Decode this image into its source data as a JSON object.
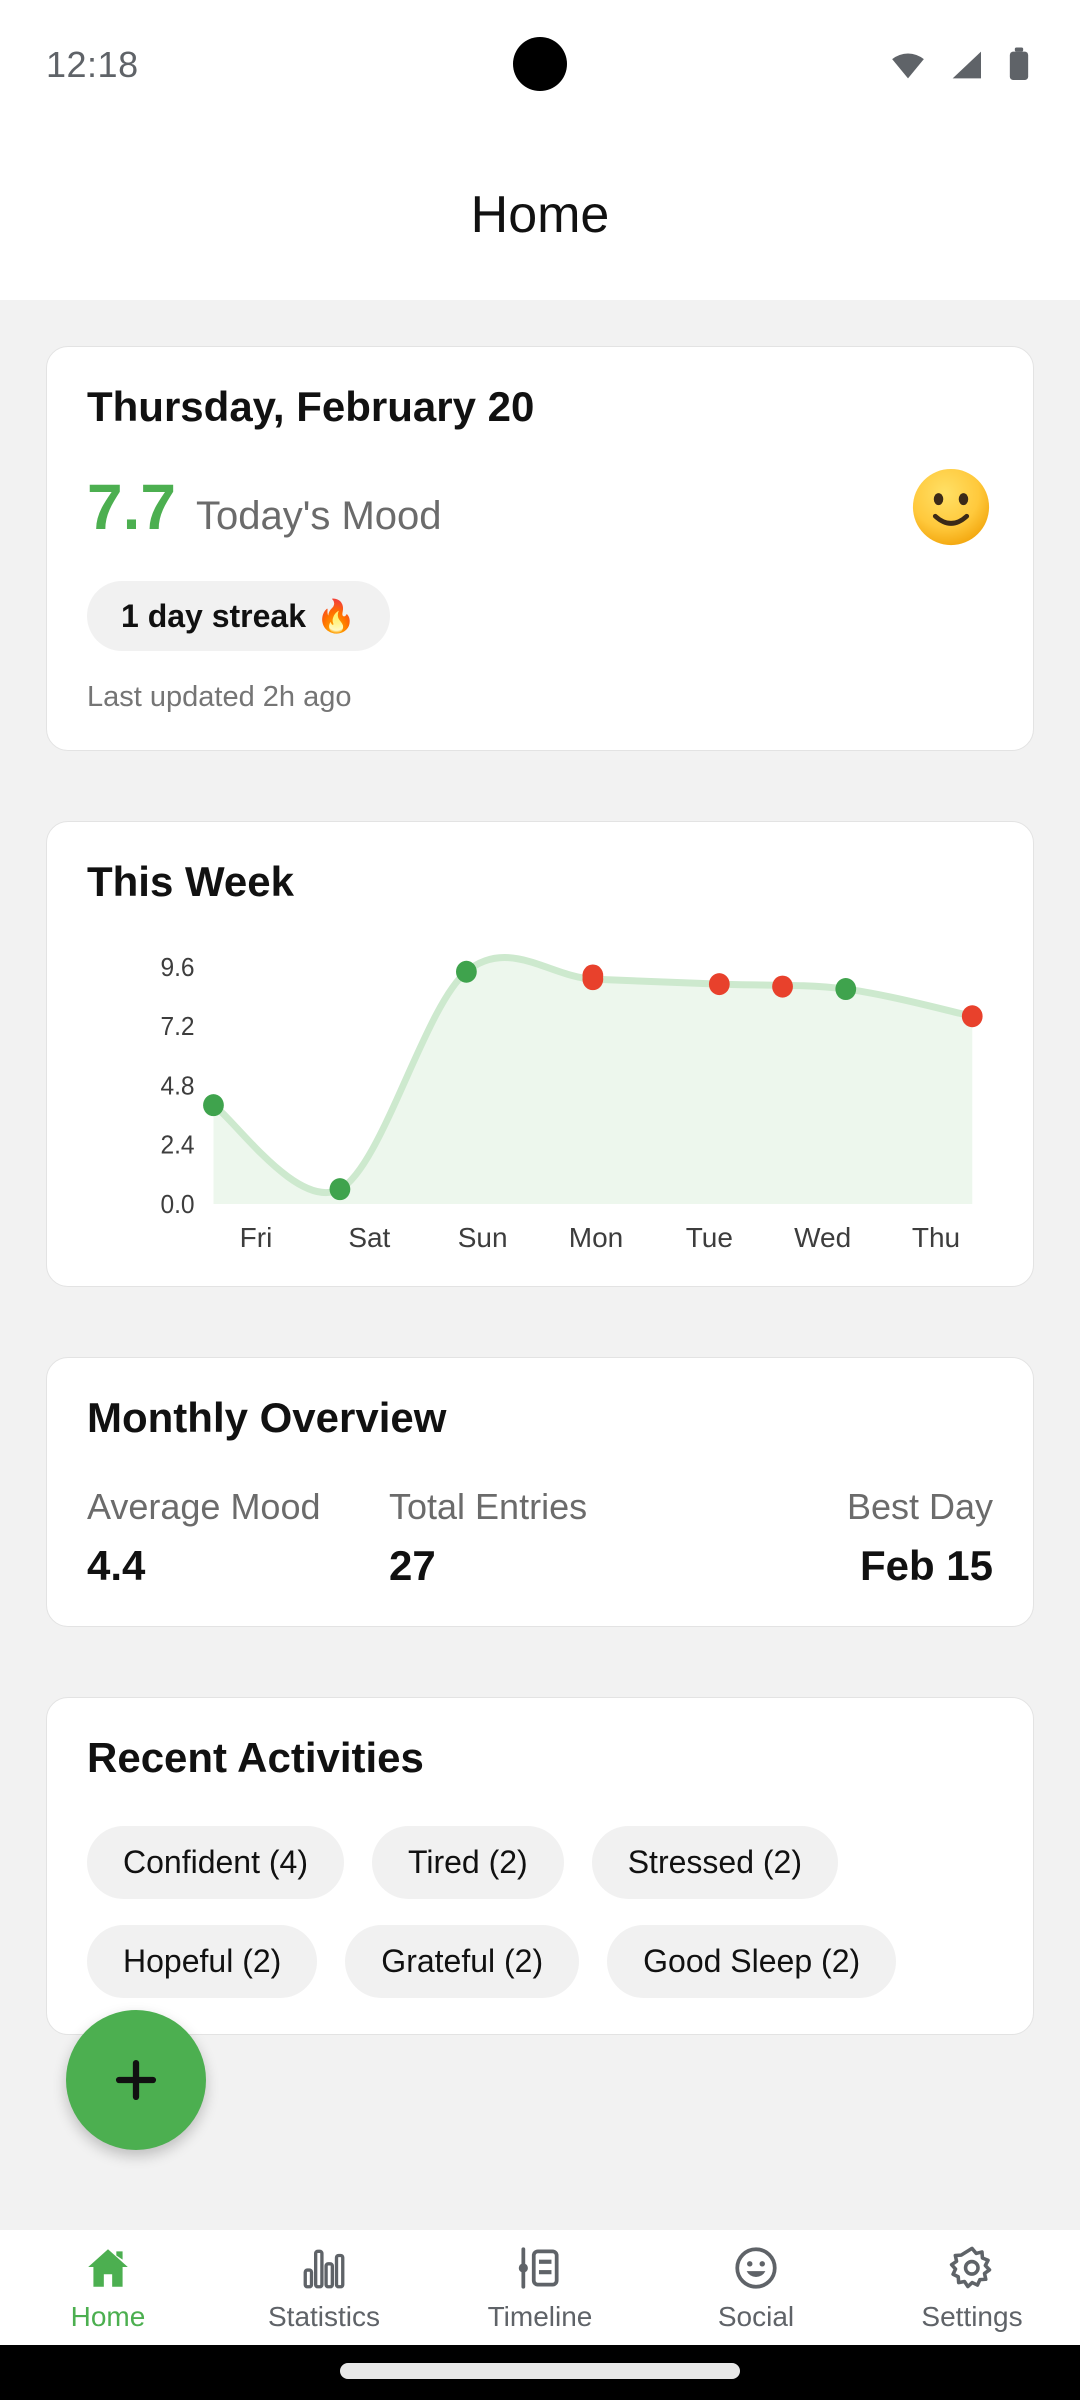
{
  "status_bar": {
    "time": "12:18",
    "icons": [
      "wifi-icon",
      "cellular-signal-icon",
      "battery-icon"
    ]
  },
  "app_bar": {
    "title": "Home"
  },
  "mood_card": {
    "date": "Thursday, February 20",
    "score": "7.7",
    "score_label": "Today's Mood",
    "emoji": "slightly-smiling-face",
    "streak": "1 day streak",
    "streak_icon": "🔥",
    "last_updated": "Last updated 2h ago"
  },
  "week_card": {
    "title": "This Week"
  },
  "chart_data": {
    "type": "area",
    "title": "This Week",
    "xlabel": "",
    "ylabel": "",
    "categories": [
      "Fri",
      "Sat",
      "Sun",
      "Mon",
      "Tue",
      "Wed",
      "Thu"
    ],
    "values": [
      4.0,
      0.6,
      9.4,
      9.1,
      8.9,
      8.7,
      7.6
    ],
    "point_colors": [
      "green",
      "green",
      "green",
      "red",
      "red",
      "green",
      "red",
      "green"
    ],
    "point_color_by_index": [
      "green",
      "green",
      "green",
      "red",
      "red",
      "green",
      "red",
      "green"
    ],
    "series": [
      {
        "name": "Mood",
        "values": [
          4.0,
          0.6,
          9.4,
          9.1,
          8.9,
          8.7,
          7.6
        ]
      }
    ],
    "extra_points": [
      {
        "x_fraction": 0.5,
        "value": 9.25,
        "color": "red"
      },
      {
        "x_fraction": 0.75,
        "value": 8.8,
        "color": "red"
      }
    ],
    "yticks": [
      "0.0",
      "2.4",
      "4.8",
      "7.2",
      "9.6"
    ],
    "ylim": [
      0.0,
      10.2
    ],
    "grid": false,
    "legend": "none",
    "line_color": "#CDE9CE",
    "fill_color": "#EDF7ED",
    "marker_green": "#3FA34D",
    "marker_red": "#E8412C"
  },
  "monthly_card": {
    "title": "Monthly Overview",
    "stats": [
      {
        "label": "Average Mood",
        "value": "4.4"
      },
      {
        "label": "Total Entries",
        "value": "27"
      },
      {
        "label": "Best Day",
        "value": "Feb 15"
      }
    ]
  },
  "activities_card": {
    "title": "Recent Activities",
    "chips": [
      "Confident (4)",
      "Tired (2)",
      "Stressed (2)",
      "Hopeful (2)",
      "Grateful (2)",
      "Good Sleep (2)"
    ]
  },
  "fab": {
    "icon": "plus-icon"
  },
  "bottom_nav": {
    "items": [
      {
        "label": "Home",
        "icon": "home-icon",
        "active": true
      },
      {
        "label": "Statistics",
        "icon": "bar-chart-icon",
        "active": false
      },
      {
        "label": "Timeline",
        "icon": "timeline-icon",
        "active": false
      },
      {
        "label": "Social",
        "icon": "smiley-face-icon",
        "active": false
      },
      {
        "label": "Settings",
        "icon": "gear-icon",
        "active": false
      }
    ]
  },
  "colors": {
    "accent_green": "#4CAF50",
    "page_background": "#F2F2F2",
    "card_background": "#FFFFFF",
    "marker_red": "#E8412C"
  }
}
